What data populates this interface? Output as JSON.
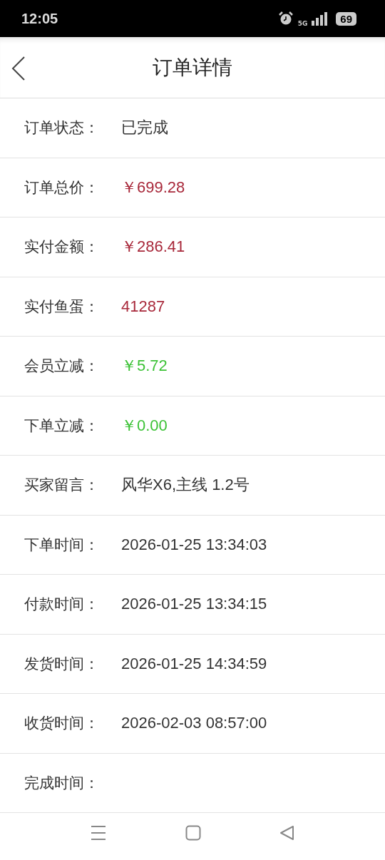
{
  "status_bar": {
    "time": "12:05",
    "network": "5G",
    "battery": "69"
  },
  "header": {
    "title": "订单详情"
  },
  "rows": [
    {
      "label": "订单状态：",
      "value": "已完成",
      "kind": "plain"
    },
    {
      "label": "订单总价：",
      "value": "￥699.28",
      "kind": "price"
    },
    {
      "label": "实付金额：",
      "value": "￥286.41",
      "kind": "price"
    },
    {
      "label": "实付鱼蛋：",
      "value": "41287",
      "kind": "price"
    },
    {
      "label": "会员立减：",
      "value": "￥5.72",
      "kind": "discount"
    },
    {
      "label": "下单立减：",
      "value": "￥0.00",
      "kind": "discount"
    },
    {
      "label": "买家留言：",
      "value": "风华X6,主线 1.2号",
      "kind": "plain"
    },
    {
      "label": "下单时间：",
      "value": "2026-01-25 13:34:03",
      "kind": "plain"
    },
    {
      "label": "付款时间：",
      "value": "2026-01-25 13:34:15",
      "kind": "plain"
    },
    {
      "label": "发货时间：",
      "value": "2026-01-25 14:34:59",
      "kind": "plain"
    },
    {
      "label": "收货时间：",
      "value": "2026-02-03 08:57:00",
      "kind": "plain"
    },
    {
      "label": "完成时间："
    }
  ]
}
